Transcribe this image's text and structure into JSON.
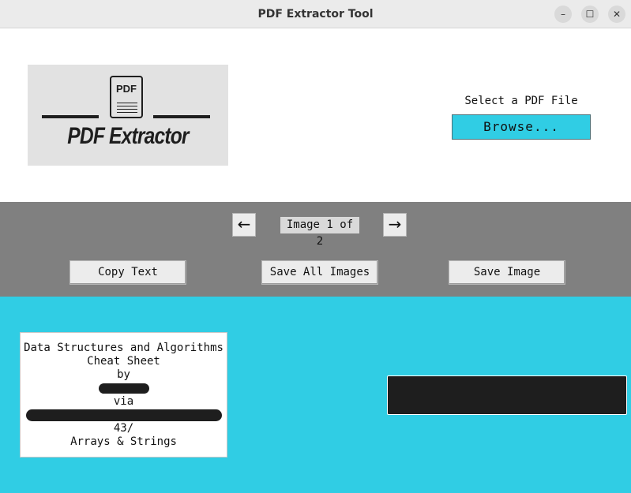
{
  "window": {
    "title": "PDF Extractor Tool",
    "minimize_glyph": "–",
    "maximize_glyph": "☐",
    "close_glyph": "✕"
  },
  "header": {
    "logo": {
      "doc_label": "PDF",
      "wordmark": "PDF Extractor"
    },
    "select_label": "Select a PDF File",
    "browse_label": "Browse...",
    "browse_color": "#30cde4"
  },
  "navigation": {
    "prev_icon": "arrow-left-icon",
    "prev_glyph": "←",
    "counter": "Image 1 of 2",
    "next_icon": "arrow-right-icon",
    "next_glyph": "→"
  },
  "actions": {
    "copy_text": "Copy Text",
    "save_all_images": "Save All Images",
    "save_image": "Save Image"
  },
  "extracted_text": {
    "lines": [
      "Data Structures and Algorithms",
      "Cheat Sheet",
      "by",
      "",
      "via",
      "",
      "43/",
      "Arrays & Strings"
    ]
  },
  "colors": {
    "content_background": "#30cde4",
    "controls_background": "#808080",
    "redaction": "#1e1e1e"
  }
}
